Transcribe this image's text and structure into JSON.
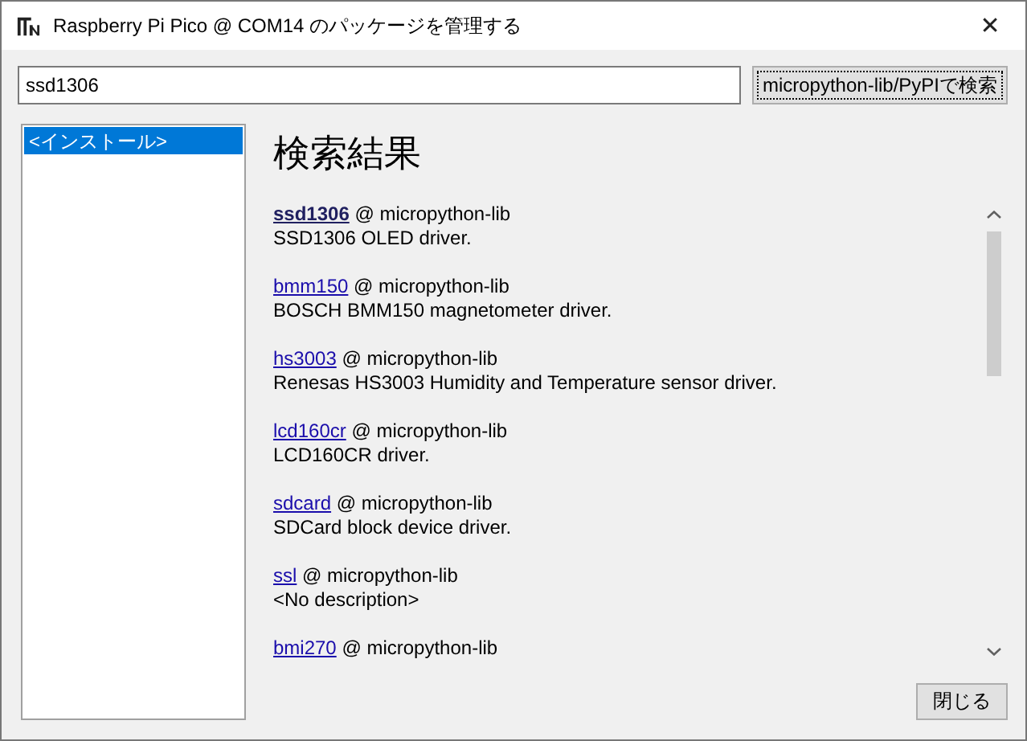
{
  "window": {
    "title": "Raspberry Pi Pico @ COM14 のパッケージを管理する",
    "close": "✕"
  },
  "search": {
    "value": "ssd1306",
    "button": "micropython-lib/PyPIで検索"
  },
  "sidebar": {
    "items": [
      {
        "label": "<インストール>",
        "selected": true
      }
    ]
  },
  "results": {
    "heading": "検索結果",
    "items": [
      {
        "name": "ssd1306",
        "source": " @ micropython-lib",
        "description": "SSD1306 OLED driver.",
        "exact_match": true
      },
      {
        "name": "bmm150",
        "source": " @ micropython-lib",
        "description": "BOSCH BMM150 magnetometer driver.",
        "exact_match": false
      },
      {
        "name": "hs3003",
        "source": " @ micropython-lib",
        "description": "Renesas HS3003 Humidity and Temperature sensor driver.",
        "exact_match": false
      },
      {
        "name": "lcd160cr",
        "source": " @ micropython-lib",
        "description": "LCD160CR driver.",
        "exact_match": false
      },
      {
        "name": "sdcard",
        "source": " @ micropython-lib",
        "description": "SDCard block device driver.",
        "exact_match": false
      },
      {
        "name": "ssl",
        "source": " @ micropython-lib",
        "description": "<No description>",
        "exact_match": false
      },
      {
        "name": "bmi270",
        "source": " @ micropython-lib",
        "exact_match": false
      }
    ]
  },
  "buttons": [
    "閉じる"
  ]
}
